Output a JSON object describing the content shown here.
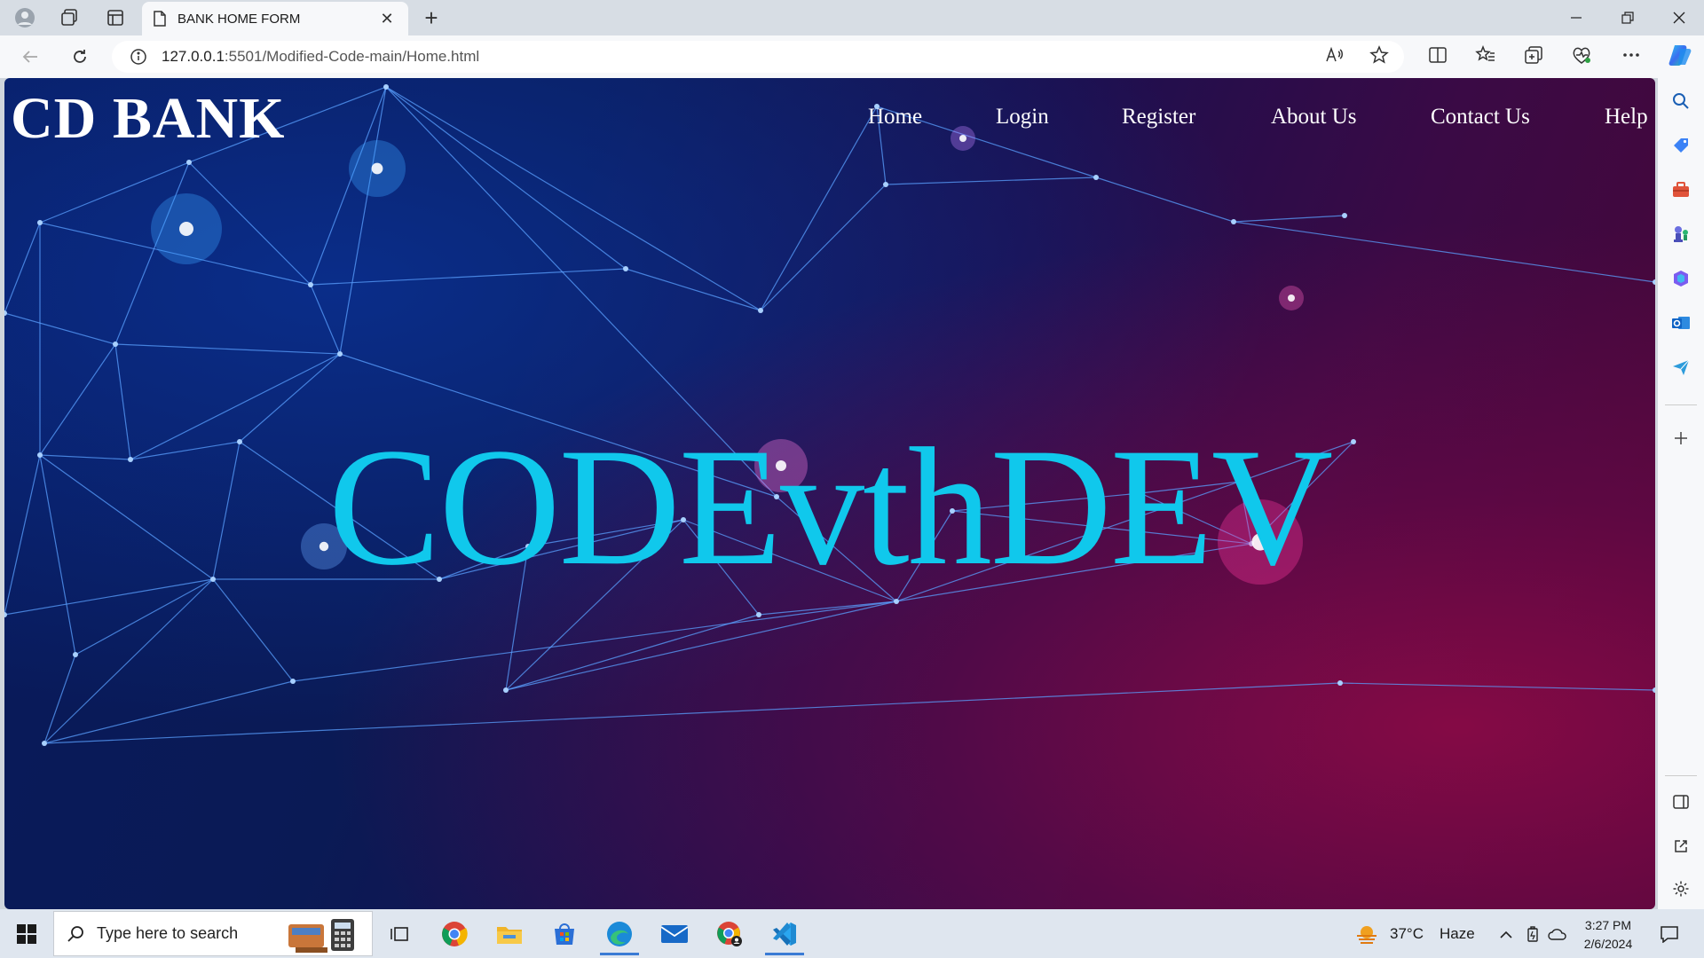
{
  "browser": {
    "tab_title": "BANK HOME FORM",
    "url_host": "127.0.0.1",
    "url_rest": ":5501/Modified-Code-main/Home.html"
  },
  "page": {
    "brand": "CD BANK",
    "nav": [
      "Home",
      "Login",
      "Register",
      "About Us",
      "Contact Us",
      "Help"
    ],
    "hero_text": "CODEvthDEV",
    "hero_color": "#10c8ec"
  },
  "taskbar": {
    "search_placeholder": "Type here to search",
    "weather_temp": "37°C",
    "weather_desc": "Haze",
    "time": "3:27 PM",
    "date": "2/6/2024"
  },
  "colors": {
    "accent": "#3a7bd5",
    "network_lines": "#5aa0ff",
    "bg_left": "#081a5c",
    "bg_right": "#4a0636"
  }
}
